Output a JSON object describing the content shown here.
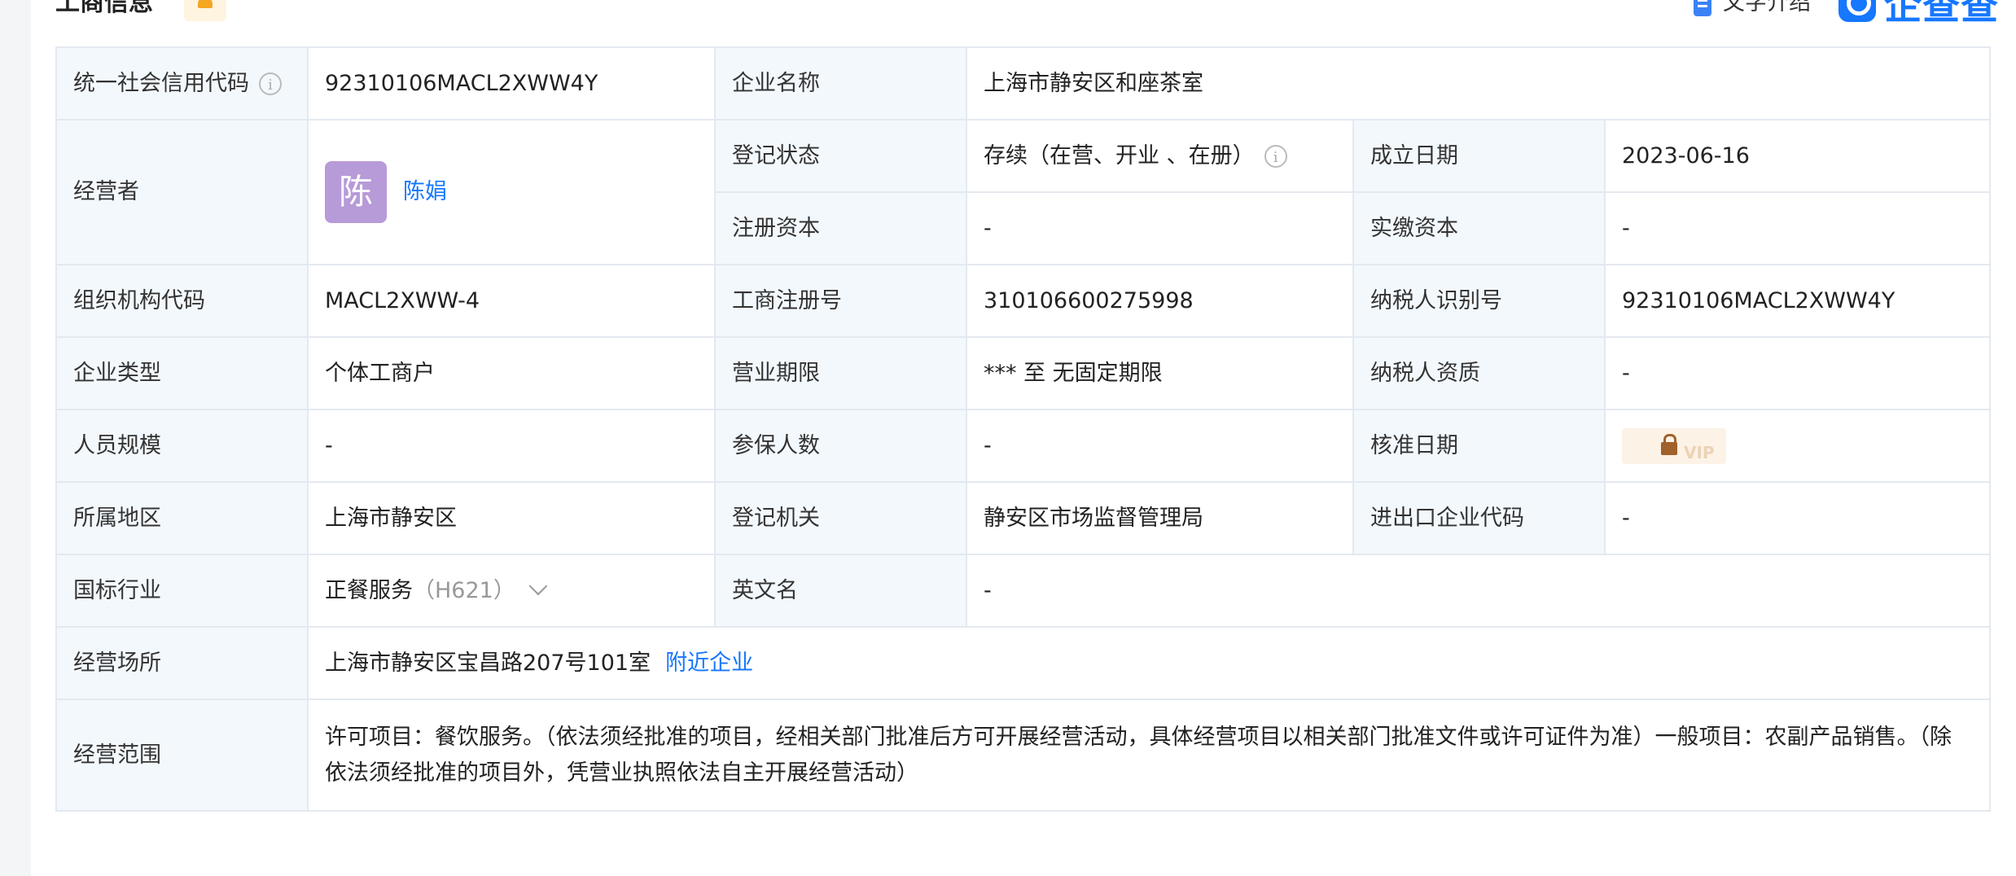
{
  "header": {
    "title": "工商信息",
    "text_intro_label": "文字介绍",
    "brand_name": "企查查"
  },
  "labels": {
    "credit_code": "统一社会信用代码",
    "company_name": "企业名称",
    "operator": "经营者",
    "reg_status": "登记状态",
    "established_date": "成立日期",
    "registered_capital": "注册资本",
    "paid_capital": "实缴资本",
    "org_code": "组织机构代码",
    "business_reg_no": "工商注册号",
    "taxpayer_id": "纳税人识别号",
    "company_type": "企业类型",
    "business_term": "营业期限",
    "taxpayer_qualification": "纳税人资质",
    "staff_size": "人员规模",
    "insured_count": "参保人数",
    "approval_date": "核准日期",
    "region": "所属地区",
    "reg_authority": "登记机关",
    "import_export_code": "进出口企业代码",
    "industry": "国标行业",
    "english_name": "英文名",
    "business_address": "经营场所",
    "business_scope": "经营范围"
  },
  "values": {
    "credit_code": "92310106MACL2XWW4Y",
    "company_name": "上海市静安区和座茶室",
    "operator_avatar": "陈",
    "operator_name": "陈娟",
    "reg_status": "存续（在营、开业 、在册）",
    "established_date": "2023-06-16",
    "registered_capital": "-",
    "paid_capital": "-",
    "org_code": "MACL2XWW-4",
    "business_reg_no": "310106600275998",
    "taxpayer_id": "92310106MACL2XWW4Y",
    "company_type": "个体工商户",
    "business_term": "*** 至 无固定期限",
    "taxpayer_qualification": "-",
    "staff_size": "-",
    "insured_count": "-",
    "approval_date_badge": "VIP",
    "region": "上海市静安区",
    "reg_authority": "静安区市场监督管理局",
    "import_export_code": "-",
    "industry_name": "正餐服务",
    "industry_code": "（H621）",
    "english_name": "-",
    "business_address": "上海市静安区宝昌路207号101室",
    "nearby_link": "附近企业",
    "business_scope": "许可项目：餐饮服务。（依法须经批准的项目，经相关部门批准后方可开展经营活动，具体经营项目以相关部门批准文件或许可证件为准）一般项目：农副产品销售。（除依法须经批准的项目外，凭营业执照依法自主开展经营活动）"
  },
  "icons": {
    "info": "info-icon",
    "bell": "bell-icon",
    "doc": "document-icon",
    "lock": "lock-icon",
    "chevron": "chevron-down-icon"
  },
  "colors": {
    "label_bg": "#f3f8fd",
    "border": "#e4e9f0",
    "link": "#1677ff",
    "avatar_bg": "#b79ad8"
  }
}
